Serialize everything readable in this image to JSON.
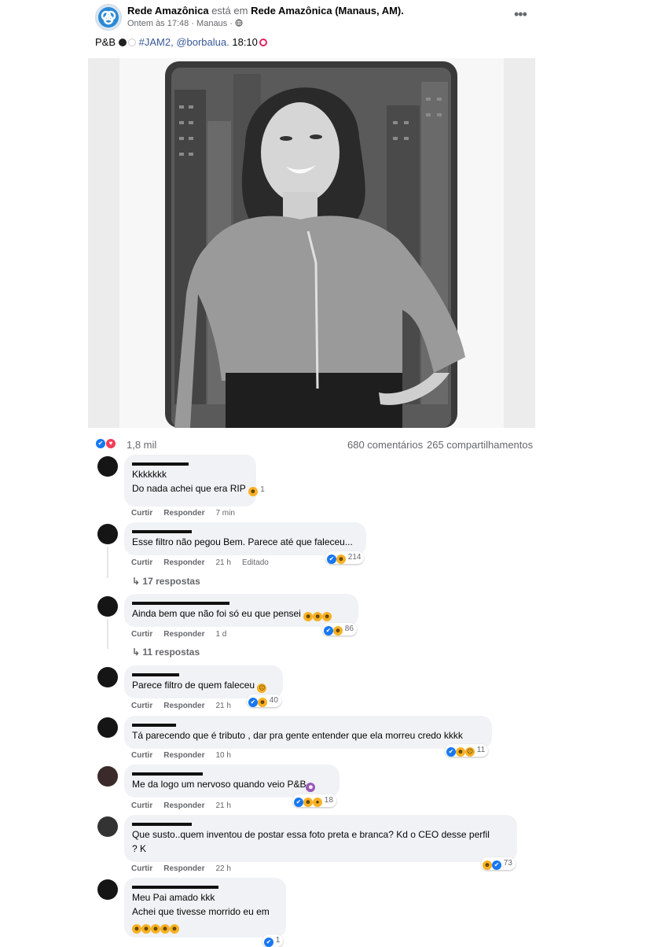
{
  "post": {
    "page_name": "Rede Amazônica",
    "is_at": "está em",
    "location": "Rede Amazônica (Manaus, AM).",
    "time": "Ontem às 17:48 · Manaus ·",
    "more_icon": "more-icon",
    "caption_prefix": "P&B",
    "caption_tags": "#JAM2, @borbalua.",
    "caption_time": "18:10",
    "reactions_count": "1,8 mil",
    "comments_count": "680 comentários",
    "shares_count": "265 compartilhamentos"
  },
  "actions": {
    "like": "Curtir",
    "reply": "Responder",
    "edited": "Editado"
  },
  "comments": [
    {
      "lines": [
        "Kkkkkkk",
        "Do nada achei que era RIP"
      ],
      "reaction_count": "1",
      "time": "7 min"
    },
    {
      "lines": [
        "Esse filtro não pegou Bem. Parece até que faleceu..."
      ],
      "reaction_count": "214",
      "time": "21 h",
      "replies": "17 respostas"
    },
    {
      "lines": [
        "Ainda bem que não foi só eu que pensei"
      ],
      "reaction_count": "86",
      "time": "1 d",
      "replies": "11 respostas"
    },
    {
      "lines": [
        "Parece filtro de quem faleceu"
      ],
      "reaction_count": "40",
      "time": "21 h"
    },
    {
      "lines": [
        "Tá parecendo que é tributo , dar pra gente entender que ela morreu credo kkkk"
      ],
      "reaction_count": "11",
      "time": "10 h"
    },
    {
      "lines": [
        "Me da logo um nervoso quando veio P&B"
      ],
      "reaction_count": "18",
      "time": "21 h"
    },
    {
      "lines": [
        "Que susto..quem inventou de postar essa foto preta e branca? Kd o CEO desse perfil",
        "? K"
      ],
      "reaction_count": "73",
      "time": "22 h"
    },
    {
      "lines": [
        "Meu Pai amado kkk",
        "Achei que tivesse morrido eu em"
      ],
      "reaction_count": "1"
    }
  ]
}
